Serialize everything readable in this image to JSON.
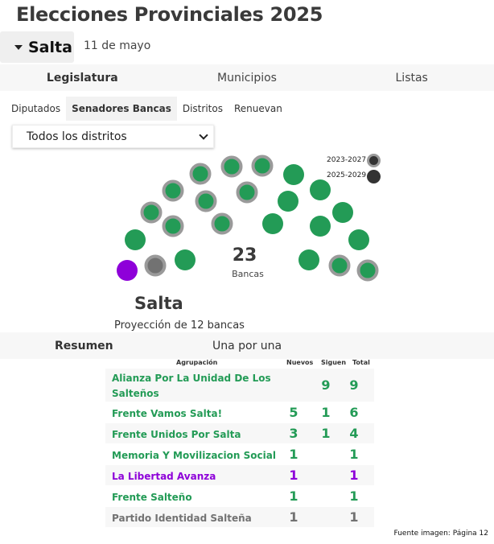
{
  "header": {
    "title": "Elecciones Provinciales 2025"
  },
  "province": {
    "label": "Salta",
    "date": "11 de mayo"
  },
  "main_tabs": [
    {
      "label": "Legislatura",
      "active": true
    },
    {
      "label": "Municipios",
      "active": false
    },
    {
      "label": "Listas",
      "active": false
    }
  ],
  "sub_tabs": [
    {
      "label": "Diputados",
      "active": false
    },
    {
      "label": "Senadores Bancas",
      "active": true
    },
    {
      "label": "Distritos",
      "active": false
    },
    {
      "label": "Renuevan",
      "active": false
    }
  ],
  "district_select": {
    "value": "Todos los distritos"
  },
  "legend": [
    {
      "label": "2023-2027",
      "style": "ringed"
    },
    {
      "label": "2025-2029",
      "style": "solid"
    }
  ],
  "seats": {
    "total": "23",
    "unit": "Bancas",
    "colors": {
      "green": "#239b56",
      "purple": "#8e00d9",
      "gray": "#727272",
      "ring": "#9a9a9a"
    },
    "list": [
      {
        "party": "purple",
        "term": "2025-2029"
      },
      {
        "party": "gray",
        "term": "2023-2027"
      },
      {
        "party": "green",
        "term": "2025-2029"
      },
      {
        "party": "green",
        "term": "2025-2029"
      },
      {
        "party": "green",
        "term": "2023-2027"
      },
      {
        "party": "green",
        "term": "2023-2027"
      },
      {
        "party": "green",
        "term": "2023-2027"
      },
      {
        "party": "green",
        "term": "2023-2027"
      },
      {
        "party": "green",
        "term": "2023-2027"
      },
      {
        "party": "green",
        "term": "2023-2027"
      },
      {
        "party": "green",
        "term": "2023-2027"
      },
      {
        "party": "green",
        "term": "2023-2027"
      },
      {
        "party": "green",
        "term": "2023-2027"
      },
      {
        "party": "green",
        "term": "2025-2029"
      },
      {
        "party": "green",
        "term": "2025-2029"
      },
      {
        "party": "green",
        "term": "2025-2029"
      },
      {
        "party": "green",
        "term": "2025-2029"
      },
      {
        "party": "green",
        "term": "2025-2029"
      },
      {
        "party": "green",
        "term": "2025-2029"
      },
      {
        "party": "green",
        "term": "2023-2027"
      },
      {
        "party": "green",
        "term": "2025-2029"
      },
      {
        "party": "green",
        "term": "2025-2029"
      },
      {
        "party": "green",
        "term": "2023-2027"
      }
    ]
  },
  "region": {
    "name": "Salta",
    "projection": "Proyección de 12 bancas"
  },
  "result_tabs": [
    {
      "label": "Resumen",
      "active": true
    },
    {
      "label": "Una por una",
      "active": false
    }
  ],
  "results": {
    "headers": {
      "party": "Agrupación",
      "new": "Nuevos",
      "continuing": "Siguen",
      "total": "Total"
    },
    "rows": [
      {
        "name": "Alianza Por La Unidad De Los Salteños",
        "name_line1": "Alianza Por La Unidad De Los",
        "name_line2": "Salteños",
        "new": "",
        "continuing": "9",
        "total": "9",
        "color": "#239b56"
      },
      {
        "name": "Frente Vamos Salta!",
        "new": "5",
        "continuing": "1",
        "total": "6",
        "color": "#239b56"
      },
      {
        "name": "Frente Unidos Por Salta",
        "new": "3",
        "continuing": "1",
        "total": "4",
        "color": "#239b56"
      },
      {
        "name": "Memoria Y Movilizacion Social",
        "new": "1",
        "continuing": "",
        "total": "1",
        "color": "#239b56"
      },
      {
        "name": "La Libertad Avanza",
        "new": "1",
        "continuing": "",
        "total": "1",
        "color": "#8e00d9"
      },
      {
        "name": "Frente Salteño",
        "new": "1",
        "continuing": "",
        "total": "1",
        "color": "#239b56"
      },
      {
        "name": "Partido Identidad Salteña",
        "new": "1",
        "continuing": "",
        "total": "1",
        "color": "#727272"
      }
    ]
  },
  "footer": {
    "source": "Fuente imagen: Página 12"
  }
}
